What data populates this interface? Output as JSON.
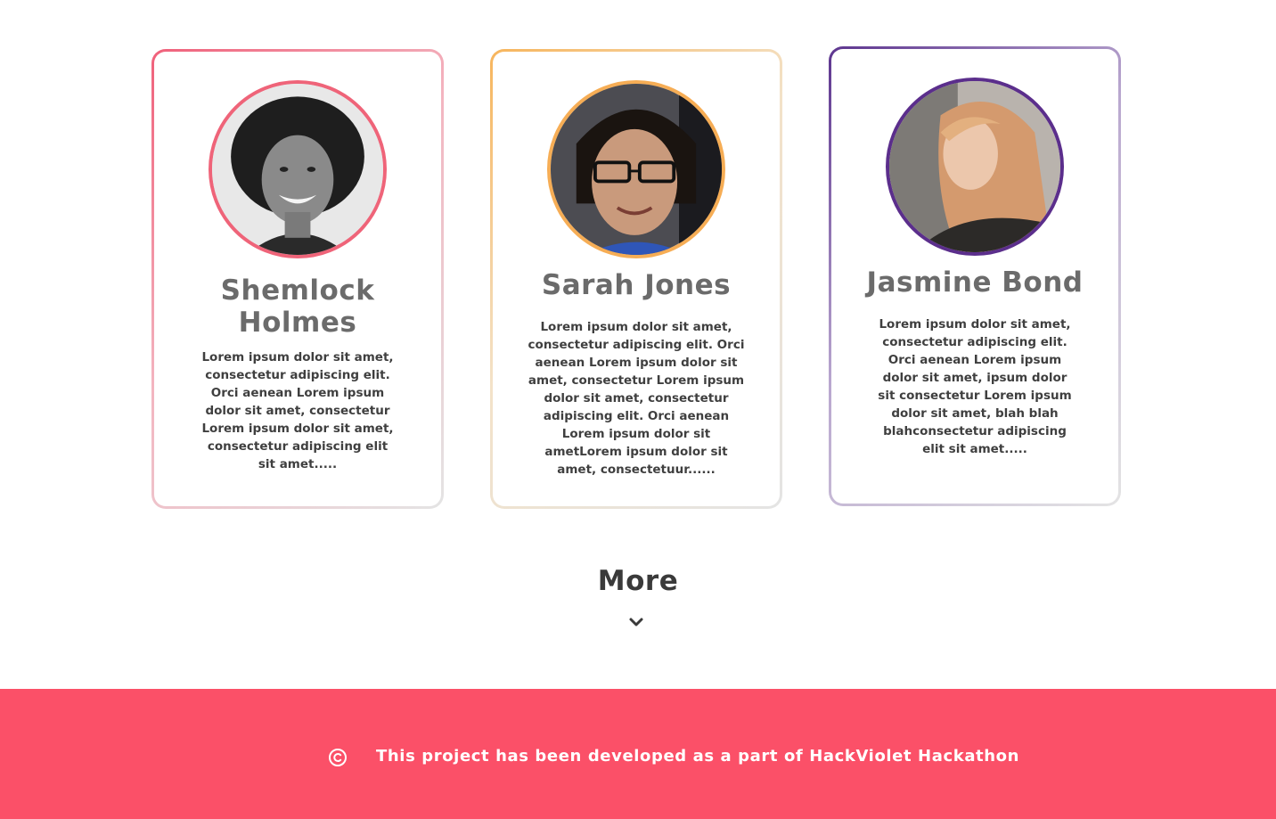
{
  "cards": [
    {
      "name": "Shemlock Holmes",
      "bio": "Lorem ipsum dolor sit amet, consectetur adipiscing elit. Orci aenean Lorem ipsum dolor sit amet, consectetur Lorem ipsum dolor sit amet, consectetur adipiscing elit sit amet.....",
      "accent": "#ef6479",
      "avatar_icon": "profile-photo"
    },
    {
      "name": "Sarah Jones",
      "bio": "Lorem ipsum dolor sit amet, consectetur adipiscing elit. Orci aenean Lorem ipsum dolor sit amet, consectetur  Lorem ipsum dolor sit amet, consectetur adipiscing elit. Orci aenean Lorem ipsum dolor sit ametLorem ipsum dolor sit amet, consectetuur......",
      "accent": "#f6ad55",
      "avatar_icon": "profile-photo"
    },
    {
      "name": "Jasmine Bond",
      "bio": "Lorem ipsum dolor sit amet, consectetur adipiscing elit. Orci aenean Lorem ipsum dolor sit amet, ipsum dolor sit consectetur  Lorem ipsum dolor sit amet, blah blah blahconsectetur adipiscing elit sit amet.....",
      "accent": "#5b2e8c",
      "avatar_icon": "profile-photo"
    }
  ],
  "more": {
    "label": "More",
    "icon": "chevron-down-icon"
  },
  "footer": {
    "text": "This project has been developed as a part of HackViolet Hackathon",
    "icon": "copyright-icon",
    "background": "#fb5068"
  }
}
